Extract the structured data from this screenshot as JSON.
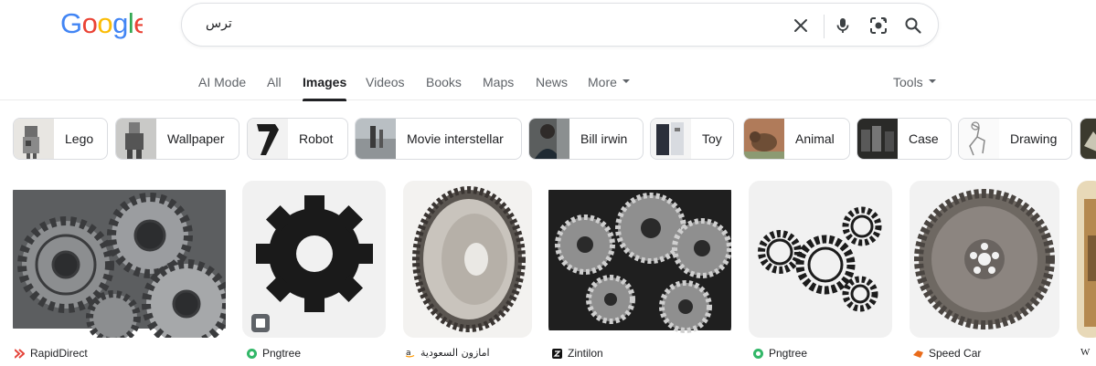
{
  "header": {
    "logo_text": "Google",
    "search_value": "ترس",
    "icons": {
      "clear": "close-icon",
      "voice": "microphone-icon",
      "lens": "camera-lens-icon",
      "search": "search-icon"
    }
  },
  "nav": {
    "tabs": [
      {
        "label": "AI Mode"
      },
      {
        "label": "All"
      },
      {
        "label": "Images"
      },
      {
        "label": "Videos"
      },
      {
        "label": "Books"
      },
      {
        "label": "Maps"
      },
      {
        "label": "News"
      },
      {
        "label": "More"
      }
    ],
    "active": "Images",
    "tools_label": "Tools"
  },
  "chips": [
    {
      "label": "Lego"
    },
    {
      "label": "Wallpaper"
    },
    {
      "label": "Robot"
    },
    {
      "label": "Movie interstellar"
    },
    {
      "label": "Bill irwin"
    },
    {
      "label": "Toy"
    },
    {
      "label": "Animal"
    },
    {
      "label": "Case"
    },
    {
      "label": "Drawing"
    }
  ],
  "results": [
    {
      "source": "RapidDirect",
      "source_icon": "rapiddirect-logo-icon"
    },
    {
      "source": "Pngtree",
      "source_icon": "pngtree-logo-icon"
    },
    {
      "source": "امازون السعودية",
      "source_icon": "amazon-logo-icon"
    },
    {
      "source": "Zintilon",
      "source_icon": "zintilon-logo-icon"
    },
    {
      "source": "Pngtree",
      "source_icon": "pngtree-logo-icon"
    },
    {
      "source": "Speed Car",
      "source_icon": "speedcar-logo-icon"
    },
    {
      "source": "W",
      "source_icon": "wikipedia-logo-icon"
    }
  ],
  "colors": {
    "google_blue": "#4285F4",
    "google_red": "#EA4335",
    "google_yellow": "#FBBC05",
    "google_green": "#34A853",
    "text_primary": "#202124",
    "text_secondary": "#5f6368",
    "border": "#dadce0"
  }
}
